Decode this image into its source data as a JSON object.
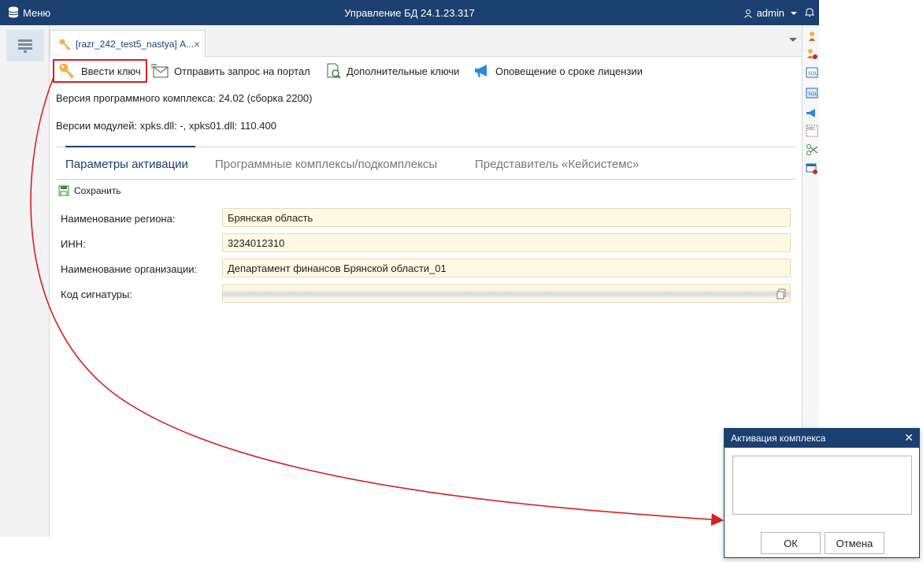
{
  "topbar": {
    "menu_label": "Меню",
    "title": "Управление БД 24.1.23.317",
    "user": "admin"
  },
  "tab": {
    "label": "[razr_242_test5_nastya] А..."
  },
  "toolbar": {
    "enter_key": "Ввести ключ",
    "send_request": "Отправить запрос на портал",
    "extra_keys": "Дополнительные ключи",
    "license_notice": "Оповещение о сроке лицензии"
  },
  "info": {
    "version": "Версия программного комплекса: 24.02 (сборка 2200)",
    "modules": "Версии модулей: xpks.dll: -, xpks01.dll: 110.400"
  },
  "subtabs": [
    {
      "label": "Параметры активации",
      "active": true
    },
    {
      "label": "Программные комплексы/подкомплексы",
      "active": false
    },
    {
      "label": "Представитель «Кейсистемс»",
      "active": false
    }
  ],
  "form": {
    "save_label": "Сохранить",
    "fields": [
      {
        "label": "Наименование региона:",
        "value": "Брянская область"
      },
      {
        "label": "ИНН:",
        "value": "3234012310"
      },
      {
        "label": "Наименование организации:",
        "value": "Департамент финансов Брянской области_01"
      },
      {
        "label": "Код сигнатуры:",
        "value": ""
      }
    ]
  },
  "dialog": {
    "title": "Активация комплекса",
    "input_value": "",
    "ok_label": "ОК",
    "cancel_label": "Отмена"
  },
  "colors": {
    "header": "#1b3f6e",
    "field_bg": "#fdf9e2",
    "highlight": "#d32222",
    "arrow": "#d32222"
  }
}
